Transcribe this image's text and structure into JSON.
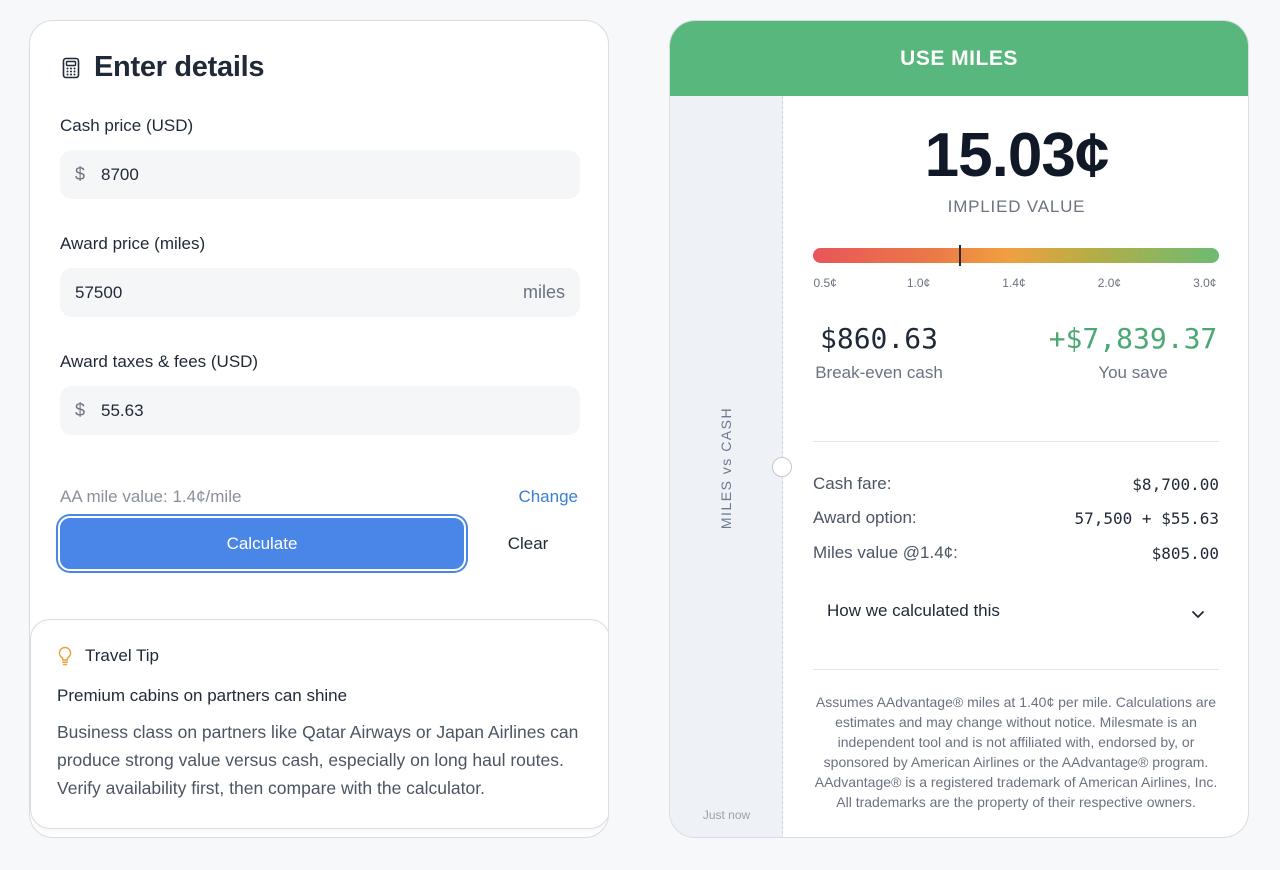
{
  "details": {
    "title": "Enter details",
    "cash_price": {
      "label": "Cash price (USD)",
      "prefix": "$",
      "value": "8700"
    },
    "award_price": {
      "label": "Award price (miles)",
      "value": "57500",
      "suffix": "miles"
    },
    "award_fees": {
      "label": "Award taxes & fees (USD)",
      "prefix": "$",
      "value": "55.63"
    },
    "mile_value_text": "AA mile value: 1.4¢/mile",
    "change_label": "Change",
    "calculate_label": "Calculate",
    "clear_label": "Clear"
  },
  "tip": {
    "title": "Travel Tip",
    "subtitle": "Premium cabins on partners can shine",
    "body": "Business class on partners like Qatar Airways or Japan Airlines can produce strong value versus cash, especially on long haul routes. Verify availability first, then compare with the calculator."
  },
  "result": {
    "banner": "USE MILES",
    "stub_label": "MILES vs CASH",
    "stub_time": "Just now",
    "implied_value": "15.03¢",
    "implied_label": "IMPLIED VALUE",
    "gauge": {
      "ticks": [
        "0.5¢",
        "1.0¢",
        "1.4¢",
        "2.0¢",
        "3.0¢"
      ],
      "marker_fraction": 0.36
    },
    "break_even": {
      "value": "$860.63",
      "label": "Break-even cash"
    },
    "savings": {
      "value": "+$7,839.37",
      "label": "You save"
    },
    "rows": [
      {
        "key": "Cash fare:",
        "value": "$8,700.00"
      },
      {
        "key": "Award option:",
        "value": "57,500 + $55.63"
      },
      {
        "key": "Miles value @1.4¢:",
        "value": "$805.00"
      }
    ],
    "accordion_label": "How we calculated this",
    "disclaimer": "Assumes AAdvantage® miles at 1.40¢ per mile. Calculations are estimates and may change without notice. Milesmate is an independent tool and is not affiliated with, endorsed by, or sponsored by American Airlines or the AAdvantage® program. AAdvantage® is a registered trademark of American Airlines, Inc. All trademarks are the property of their respective owners."
  },
  "colors": {
    "accent": "#4a86e8",
    "banner_green": "#58b77c",
    "savings_green": "#4aa872",
    "link_blue": "#3b7fd4"
  },
  "icons": {
    "header": "calculator-icon",
    "tip": "lightbulb-icon",
    "accordion": "chevron-down-icon"
  }
}
